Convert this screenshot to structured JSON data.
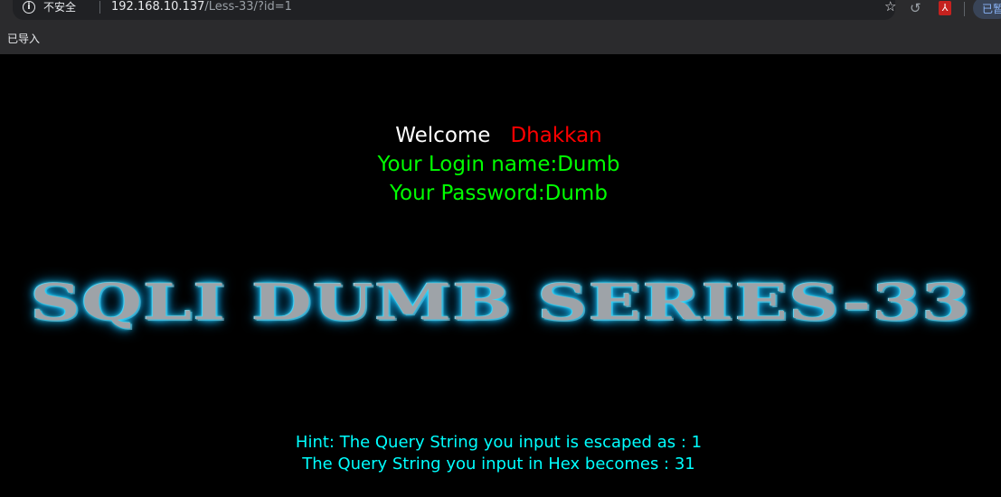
{
  "browser": {
    "security_label": "不安全",
    "url_host": "192.168.10.137",
    "url_path": "/Less-33/?id=1",
    "bookmark_label": "已导入",
    "profile_label": "已暂",
    "icons": [
      "info-icon",
      "star-icon",
      "history-icon",
      "pdf-icon"
    ]
  },
  "page": {
    "welcome_word": "Welcome",
    "welcome_name": "Dhakkan",
    "login_line": "Your Login name:Dumb",
    "password_line": "Your Password:Dumb",
    "banner_title": "SQLI DUMB SERIES-33",
    "hint_line1": "Hint: The Query String you input is escaped as : 1",
    "hint_line2": "The Query String you input in Hex becomes : 31"
  },
  "colors": {
    "background": "#000000",
    "welcome": "#ffffff",
    "name": "#ff0000",
    "login_text": "#00ff00",
    "hint_text": "#00ffff",
    "banner_glow": "#1ccfff"
  }
}
